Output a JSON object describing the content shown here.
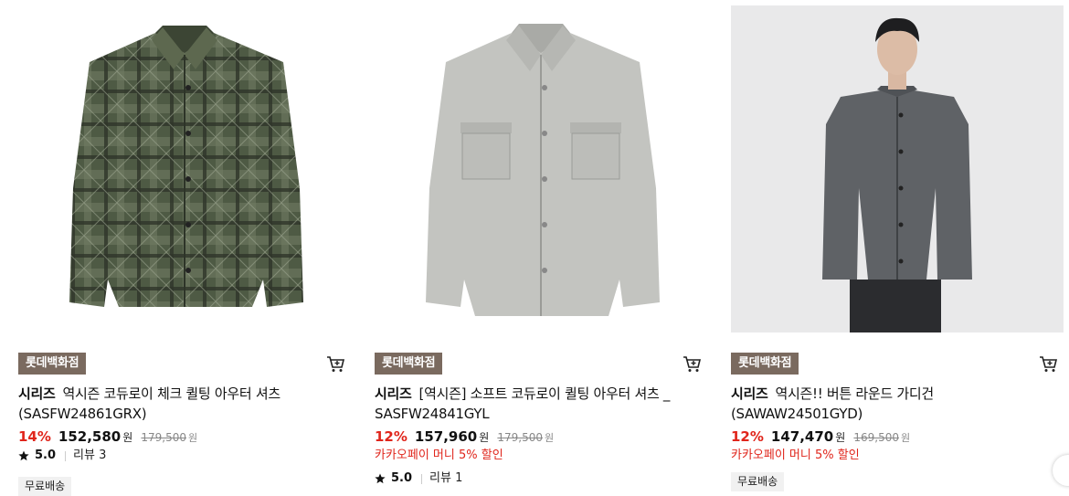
{
  "products": [
    {
      "store": "롯데백화점",
      "brand": "시리즈",
      "name": "역시즌 코듀로이 체크 퀼팅 아우터 셔츠",
      "code": "(SASFW24861GRX)",
      "discount": "14%",
      "price": "152,580",
      "currency": "원",
      "original_price": "179,500",
      "promo": "",
      "rating": "5.0",
      "reviews": "리뷰 3",
      "shipping": "무료배송",
      "image": "green-plaid-quilted-shirt-jacket",
      "cart_icon": "cart-icon"
    },
    {
      "store": "롯데백화점",
      "brand": "시리즈",
      "name": "[역시즌] 소프트 코듀로이 퀼팅 아우터 셔츠 _",
      "code": "SASFW24841GYL",
      "discount": "12%",
      "price": "157,960",
      "currency": "원",
      "original_price": "179,500",
      "promo": "카카오페이 머니 5% 할인",
      "rating": "5.0",
      "reviews": "리뷰 1",
      "shipping": "",
      "image": "grey-corduroy-shirt-jacket",
      "cart_icon": "cart-icon"
    },
    {
      "store": "롯데백화점",
      "brand": "시리즈",
      "name": "역시즌!! 버튼 라운드 가디건",
      "code": "(SAWAW24501GYD)",
      "discount": "12%",
      "price": "147,470",
      "currency": "원",
      "original_price": "169,500",
      "promo": "카카오페이 머니 5% 할인",
      "rating": "",
      "reviews": "",
      "shipping": "무료배송",
      "image": "model-grey-cardigan",
      "cart_icon": "cart-icon"
    }
  ],
  "colors": {
    "badge": "#7a6a5f",
    "discount": "#e0251b",
    "ship_bg": "#f1f1f1"
  }
}
